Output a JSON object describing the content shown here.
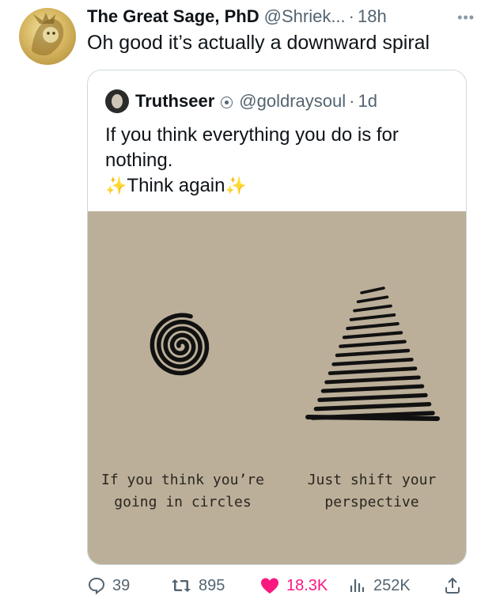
{
  "tweet": {
    "author_name": "The Great Sage, PhD",
    "handle": "@Shriek...",
    "separator": "·",
    "time": "18h",
    "more_label": "•••",
    "text": "Oh good it’s actually a downward spiral"
  },
  "quote": {
    "author_name": "Truthseer",
    "handle": "@goldraysoul",
    "separator": "·",
    "time": "1d",
    "text_line1": "If you think everything you do is for",
    "text_line2": "nothing.",
    "sparkle": "✨",
    "text_line3": "Think again",
    "image": {
      "caption_left": "If you think you’re\ngoing in circles",
      "caption_right": "Just shift your\nperspective"
    }
  },
  "actions": {
    "replies": "39",
    "reposts": "895",
    "likes": "18.3K",
    "views": "252K"
  },
  "colors": {
    "like": "#f91880",
    "muted": "#536471",
    "image_bg": "#bcaf99"
  }
}
